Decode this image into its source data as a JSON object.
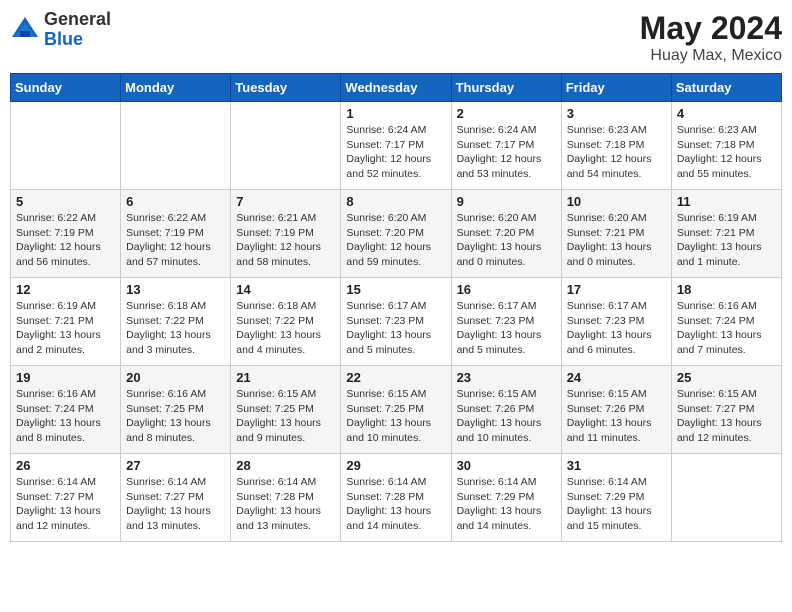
{
  "header": {
    "logo_general": "General",
    "logo_blue": "Blue",
    "month_title": "May 2024",
    "location": "Huay Max, Mexico"
  },
  "columns": [
    "Sunday",
    "Monday",
    "Tuesday",
    "Wednesday",
    "Thursday",
    "Friday",
    "Saturday"
  ],
  "weeks": [
    [
      {
        "day": "",
        "info": ""
      },
      {
        "day": "",
        "info": ""
      },
      {
        "day": "",
        "info": ""
      },
      {
        "day": "1",
        "info": "Sunrise: 6:24 AM\nSunset: 7:17 PM\nDaylight: 12 hours\nand 52 minutes."
      },
      {
        "day": "2",
        "info": "Sunrise: 6:24 AM\nSunset: 7:17 PM\nDaylight: 12 hours\nand 53 minutes."
      },
      {
        "day": "3",
        "info": "Sunrise: 6:23 AM\nSunset: 7:18 PM\nDaylight: 12 hours\nand 54 minutes."
      },
      {
        "day": "4",
        "info": "Sunrise: 6:23 AM\nSunset: 7:18 PM\nDaylight: 12 hours\nand 55 minutes."
      }
    ],
    [
      {
        "day": "5",
        "info": "Sunrise: 6:22 AM\nSunset: 7:19 PM\nDaylight: 12 hours\nand 56 minutes."
      },
      {
        "day": "6",
        "info": "Sunrise: 6:22 AM\nSunset: 7:19 PM\nDaylight: 12 hours\nand 57 minutes."
      },
      {
        "day": "7",
        "info": "Sunrise: 6:21 AM\nSunset: 7:19 PM\nDaylight: 12 hours\nand 58 minutes."
      },
      {
        "day": "8",
        "info": "Sunrise: 6:20 AM\nSunset: 7:20 PM\nDaylight: 12 hours\nand 59 minutes."
      },
      {
        "day": "9",
        "info": "Sunrise: 6:20 AM\nSunset: 7:20 PM\nDaylight: 13 hours\nand 0 minutes."
      },
      {
        "day": "10",
        "info": "Sunrise: 6:20 AM\nSunset: 7:21 PM\nDaylight: 13 hours\nand 0 minutes."
      },
      {
        "day": "11",
        "info": "Sunrise: 6:19 AM\nSunset: 7:21 PM\nDaylight: 13 hours\nand 1 minute."
      }
    ],
    [
      {
        "day": "12",
        "info": "Sunrise: 6:19 AM\nSunset: 7:21 PM\nDaylight: 13 hours\nand 2 minutes."
      },
      {
        "day": "13",
        "info": "Sunrise: 6:18 AM\nSunset: 7:22 PM\nDaylight: 13 hours\nand 3 minutes."
      },
      {
        "day": "14",
        "info": "Sunrise: 6:18 AM\nSunset: 7:22 PM\nDaylight: 13 hours\nand 4 minutes."
      },
      {
        "day": "15",
        "info": "Sunrise: 6:17 AM\nSunset: 7:23 PM\nDaylight: 13 hours\nand 5 minutes."
      },
      {
        "day": "16",
        "info": "Sunrise: 6:17 AM\nSunset: 7:23 PM\nDaylight: 13 hours\nand 5 minutes."
      },
      {
        "day": "17",
        "info": "Sunrise: 6:17 AM\nSunset: 7:23 PM\nDaylight: 13 hours\nand 6 minutes."
      },
      {
        "day": "18",
        "info": "Sunrise: 6:16 AM\nSunset: 7:24 PM\nDaylight: 13 hours\nand 7 minutes."
      }
    ],
    [
      {
        "day": "19",
        "info": "Sunrise: 6:16 AM\nSunset: 7:24 PM\nDaylight: 13 hours\nand 8 minutes."
      },
      {
        "day": "20",
        "info": "Sunrise: 6:16 AM\nSunset: 7:25 PM\nDaylight: 13 hours\nand 8 minutes."
      },
      {
        "day": "21",
        "info": "Sunrise: 6:15 AM\nSunset: 7:25 PM\nDaylight: 13 hours\nand 9 minutes."
      },
      {
        "day": "22",
        "info": "Sunrise: 6:15 AM\nSunset: 7:25 PM\nDaylight: 13 hours\nand 10 minutes."
      },
      {
        "day": "23",
        "info": "Sunrise: 6:15 AM\nSunset: 7:26 PM\nDaylight: 13 hours\nand 10 minutes."
      },
      {
        "day": "24",
        "info": "Sunrise: 6:15 AM\nSunset: 7:26 PM\nDaylight: 13 hours\nand 11 minutes."
      },
      {
        "day": "25",
        "info": "Sunrise: 6:15 AM\nSunset: 7:27 PM\nDaylight: 13 hours\nand 12 minutes."
      }
    ],
    [
      {
        "day": "26",
        "info": "Sunrise: 6:14 AM\nSunset: 7:27 PM\nDaylight: 13 hours\nand 12 minutes."
      },
      {
        "day": "27",
        "info": "Sunrise: 6:14 AM\nSunset: 7:27 PM\nDaylight: 13 hours\nand 13 minutes."
      },
      {
        "day": "28",
        "info": "Sunrise: 6:14 AM\nSunset: 7:28 PM\nDaylight: 13 hours\nand 13 minutes."
      },
      {
        "day": "29",
        "info": "Sunrise: 6:14 AM\nSunset: 7:28 PM\nDaylight: 13 hours\nand 14 minutes."
      },
      {
        "day": "30",
        "info": "Sunrise: 6:14 AM\nSunset: 7:29 PM\nDaylight: 13 hours\nand 14 minutes."
      },
      {
        "day": "31",
        "info": "Sunrise: 6:14 AM\nSunset: 7:29 PM\nDaylight: 13 hours\nand 15 minutes."
      },
      {
        "day": "",
        "info": ""
      }
    ]
  ]
}
